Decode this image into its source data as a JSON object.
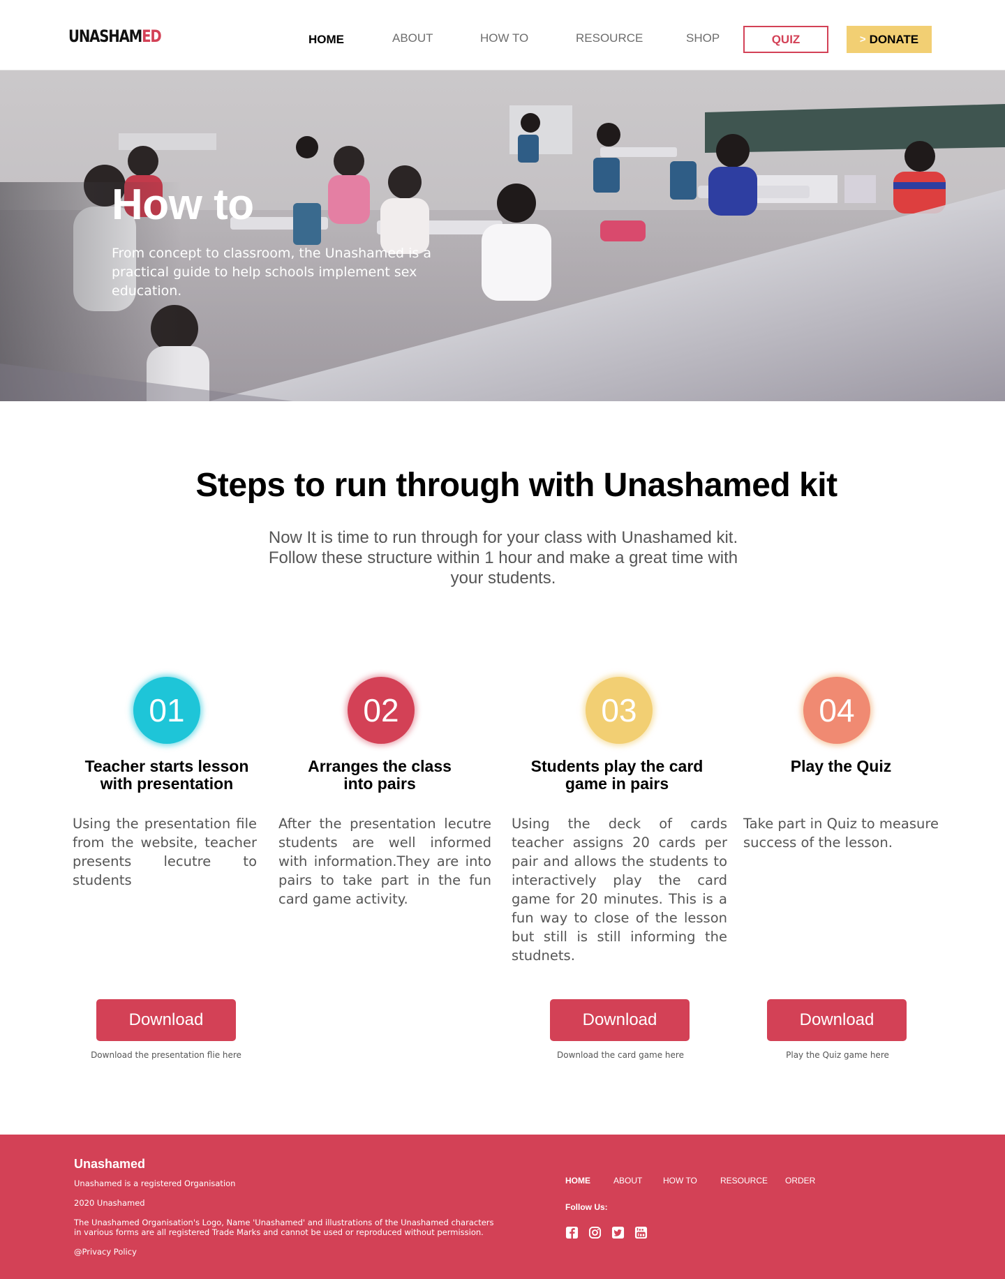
{
  "header": {
    "logo_part1": "UNASHAM",
    "logo_part2": "ED",
    "nav": [
      "HOME",
      "ABOUT",
      "HOW TO",
      "RESOURCE",
      "SHOP"
    ],
    "quiz_label": "QUIZ",
    "donate_chevron": ">",
    "donate_label": "DONATE"
  },
  "hero": {
    "title": "How to",
    "subtitle": "From concept to classroom, the Unashamed is a practical guide to help schools implement sex education."
  },
  "intro": {
    "title": "Steps to run through with Unashamed kit",
    "subtitle": "Now It is time to run through for your class with Unashamed kit. Follow these structure within 1 hour and make a great time with your students."
  },
  "steps": [
    {
      "number": "01",
      "color": "#1ec5d8",
      "title_line1": "Teacher starts lesson",
      "title_line2": "with presentation",
      "body": "Using the presentation file from the website, teacher presents lecutre to students",
      "button": "Download",
      "caption": "Download the presentation flie here"
    },
    {
      "number": "02",
      "color": "#d34156",
      "title_line1": "Arranges the class",
      "title_line2": "into pairs",
      "body": "After the presentation lecutre students are well informed with information.They are into pairs to take part in the fun card game activity."
    },
    {
      "number": "03",
      "color": "#f2cf73",
      "title_line1": "Students play the card",
      "title_line2": "game in pairs",
      "body": "Using the deck of cards teacher assigns 20 cards per pair and allows the students to interactively play the card game for 20 minutes. This is a fun way to close of the lesson but still is still informing the studnets.",
      "button": "Download",
      "caption": "Download the card game here"
    },
    {
      "number": "04",
      "color": "#f08a72",
      "title_line1": "Play the Quiz",
      "body": "Take part in Quiz to measure success of the lesson.",
      "button": "Download",
      "caption": "Play the Quiz game here"
    }
  ],
  "footer": {
    "brand": "Unashamed",
    "registered": "Unashamed is a registered Organisation",
    "year": "2020 Unashamed",
    "legal_line1": "The Unashamed Organisation's Logo, Name 'Unashamed' and illustrations of the Unashamed characters",
    "legal_line2": "in various forms are all registered Trade Marks and cannot be used or reproduced without permission.",
    "privacy": "@Privacy Policy",
    "nav": [
      "HOME",
      "ABOUT",
      "HOW TO",
      "RESOURCE",
      "ORDER"
    ],
    "follow_label": "Follow Us:",
    "social_icons": [
      "facebook-icon",
      "instagram-icon",
      "twitter-icon",
      "youtube-icon"
    ]
  },
  "colors": {
    "brand_red": "#d34156",
    "donate_yellow": "#f2cf73",
    "teal": "#1ec5d8",
    "salmon": "#f08a72"
  }
}
